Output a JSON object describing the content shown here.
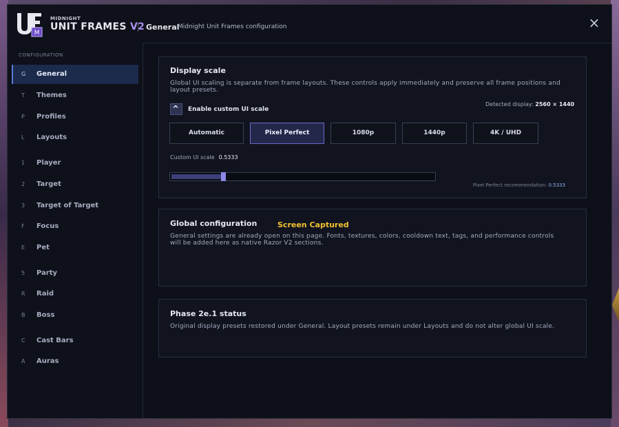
{
  "header": {
    "brand_top": "MIDNIGHT",
    "brand_main": "UNIT FRAMES",
    "brand_version": "V2",
    "logo_letters": "UF",
    "logo_badge": "M",
    "breadcrumb": "General",
    "breadcrumb_sub": "Midnight Unit Frames configuration",
    "close_icon": "×"
  },
  "sidebar": {
    "heading": "CONFIGURATION",
    "items": [
      {
        "key": "G",
        "label": "General"
      },
      {
        "key": "T",
        "label": "Themes"
      },
      {
        "key": "P",
        "label": "Profiles"
      },
      {
        "key": "L",
        "label": "Layouts"
      },
      {
        "key": "1",
        "label": "Player"
      },
      {
        "key": "2",
        "label": "Target"
      },
      {
        "key": "3",
        "label": "Target of Target"
      },
      {
        "key": "F",
        "label": "Focus"
      },
      {
        "key": "E",
        "label": "Pet"
      },
      {
        "key": "5",
        "label": "Party"
      },
      {
        "key": "R",
        "label": "Raid"
      },
      {
        "key": "B",
        "label": "Boss"
      },
      {
        "key": "C",
        "label": "Cast Bars"
      },
      {
        "key": "A",
        "label": "Auras"
      }
    ]
  },
  "display_scale": {
    "title": "Display scale",
    "description_line1": "Global UI scaling is separate from frame layouts. These controls apply immediately and preserve all frame positions and",
    "description_line2": "layout presets.",
    "checkbox_label": "Enable custom UI scale",
    "checkbox_checked": true,
    "detected_label": "Detected display:",
    "detected_value": "2560 × 1440",
    "presets": [
      "Automatic",
      "Pixel Perfect",
      "1080p",
      "1440p",
      "4K / UHD"
    ],
    "selected_preset": "Pixel Perfect",
    "custom_scale_label": "Custom UI scale",
    "custom_scale_value": "0.5333",
    "slider_fraction": 0.19,
    "recommendation_label": "Pixel Perfect recommendation:",
    "recommendation_value": "0.5333"
  },
  "global_config": {
    "title": "Global configuration",
    "overlay": "Screen Captured",
    "text_line1": "General settings are already open on this page. Fonts, textures, colors, cooldown text, tags, and performance controls",
    "text_line2": "will be added here as native Razor V2 sections."
  },
  "phase_status": {
    "title": "Phase 2e.1 status",
    "text": "Original display presets restored under General. Layout presets remain under Layouts and do not alter global UI scale."
  },
  "colors": {
    "accent": "#a98ef0",
    "active_nav": "#1c2a4c",
    "overlay_text": "#f2c230",
    "slider_thumb": "#8a88e8"
  }
}
